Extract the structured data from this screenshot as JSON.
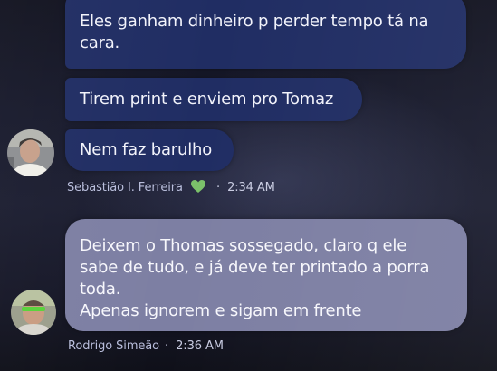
{
  "messages": [
    {
      "text": "Eles ganham dinheiro p perder tempo tá na cara."
    },
    {
      "text": "Tirem print e enviem pro Tomaz"
    },
    {
      "text": "Nem faz barulho"
    },
    {
      "line1": "Deixem o Thomas sossegado, claro q ele",
      "line2": "sabe de tudo, e já deve ter printado a porra",
      "line3": "toda.",
      "line4": "Apenas ignorem e sigam em frente"
    }
  ],
  "senders": [
    {
      "name": "Sebastião I. Ferreira",
      "separator": "·",
      "time": "2:34 AM",
      "reaction_icon": "green-heart-icon",
      "reaction_color": "#7bc16a"
    },
    {
      "name": "Rodrigo Simeão",
      "separator": "·",
      "time": "2:36 AM"
    }
  ],
  "colors": {
    "outgoing_bubble": "#202d63",
    "highlighted_bubble": "#7d7fa3",
    "sender_text": "#b9bedc"
  }
}
